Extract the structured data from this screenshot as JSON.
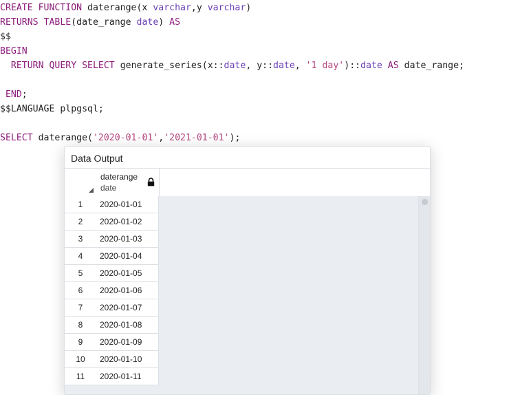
{
  "colors": {
    "keyword": "#8b1a7a",
    "type": "#6b3fb5",
    "string": "#b5457f",
    "plain": "#222222",
    "panel_border": "#dcdfe3",
    "grid_background": "#eaedf2"
  },
  "editor": {
    "lines": [
      [
        {
          "t": "CREATE FUNCTION",
          "c": "kw"
        },
        {
          "t": " daterange(x ",
          "c": "pl"
        },
        {
          "t": "varchar",
          "c": "ty"
        },
        {
          "t": ",y ",
          "c": "pl"
        },
        {
          "t": "varchar",
          "c": "ty"
        },
        {
          "t": ")",
          "c": "pl"
        }
      ],
      [
        {
          "t": "RETURNS TABLE",
          "c": "kw"
        },
        {
          "t": "(date_range ",
          "c": "pl"
        },
        {
          "t": "date",
          "c": "ty"
        },
        {
          "t": ") ",
          "c": "pl"
        },
        {
          "t": "AS",
          "c": "kw"
        }
      ],
      [
        {
          "t": "$$",
          "c": "pl"
        }
      ],
      [
        {
          "t": "BEGIN",
          "c": "kw"
        }
      ],
      [
        {
          "t": "  ",
          "c": "pl"
        },
        {
          "t": "RETURN QUERY SELECT",
          "c": "kw"
        },
        {
          "t": " generate_series(x::",
          "c": "pl"
        },
        {
          "t": "date",
          "c": "ty"
        },
        {
          "t": ", y::",
          "c": "pl"
        },
        {
          "t": "date",
          "c": "ty"
        },
        {
          "t": ", ",
          "c": "pl"
        },
        {
          "t": "'1 day'",
          "c": "st"
        },
        {
          "t": ")::",
          "c": "pl"
        },
        {
          "t": "date",
          "c": "ty"
        },
        {
          "t": " ",
          "c": "pl"
        },
        {
          "t": "AS",
          "c": "kw"
        },
        {
          "t": " date_range;",
          "c": "pl"
        }
      ],
      [],
      [
        {
          "t": " ",
          "c": "pl"
        },
        {
          "t": "END",
          "c": "kw"
        },
        {
          "t": ";",
          "c": "pl"
        }
      ],
      [
        {
          "t": "$$LANGUAGE plpgsql;",
          "c": "pl"
        }
      ],
      [],
      [
        {
          "t": "SELECT",
          "c": "kw"
        },
        {
          "t": " daterange(",
          "c": "pl"
        },
        {
          "t": "'2020-01-01'",
          "c": "st"
        },
        {
          "t": ",",
          "c": "pl"
        },
        {
          "t": "'2021-01-01'",
          "c": "st"
        },
        {
          "t": ");",
          "c": "pl"
        }
      ]
    ]
  },
  "data_output": {
    "title": "Data Output",
    "column": {
      "name": "daterange",
      "type": "date",
      "icon": "lock-icon"
    },
    "rows": [
      {
        "num": "1",
        "value": "2020-01-01"
      },
      {
        "num": "2",
        "value": "2020-01-02"
      },
      {
        "num": "3",
        "value": "2020-01-03"
      },
      {
        "num": "4",
        "value": "2020-01-04"
      },
      {
        "num": "5",
        "value": "2020-01-05"
      },
      {
        "num": "6",
        "value": "2020-01-06"
      },
      {
        "num": "7",
        "value": "2020-01-07"
      },
      {
        "num": "8",
        "value": "2020-01-08"
      },
      {
        "num": "9",
        "value": "2020-01-09"
      },
      {
        "num": "10",
        "value": "2020-01-10"
      },
      {
        "num": "11",
        "value": "2020-01-11"
      }
    ]
  }
}
